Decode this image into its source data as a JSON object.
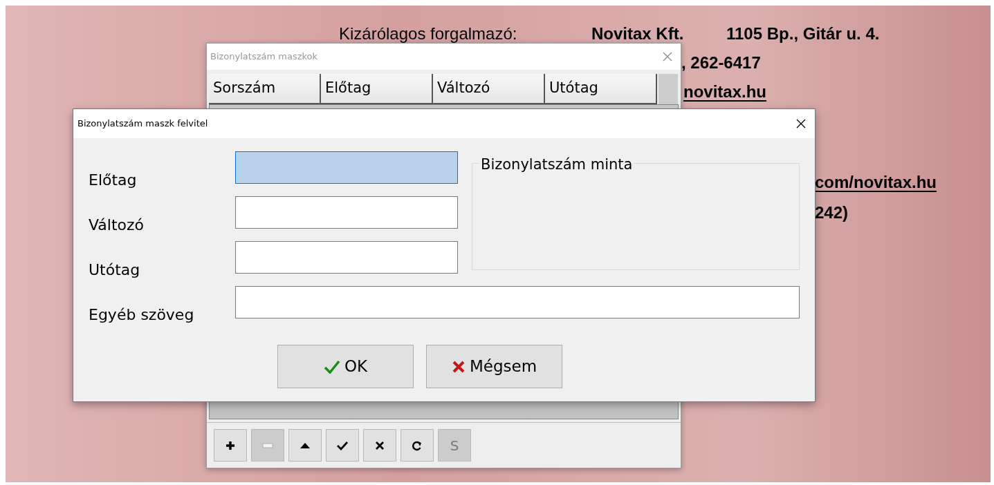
{
  "background_text": [
    {
      "text": "Kizárólagos forgalmazó:",
      "bold": false,
      "underline": false
    },
    {
      "text": "Novitax Kft.",
      "bold": true,
      "underline": false
    },
    {
      "text": "1105 Bp., Gitár u. 4.",
      "bold": true,
      "underline": false
    },
    {
      "text": ", 262-6417",
      "bold": true,
      "underline": false
    },
    {
      "text": "novitax.hu",
      "bold": true,
      "underline": true
    },
    {
      "text": "com/novitax.hu",
      "bold": true,
      "underline": true
    },
    {
      "text": "242)",
      "bold": true,
      "underline": false
    }
  ],
  "back_window": {
    "title": "Bizonylatszám maszkok",
    "columns": [
      "Sorszám",
      "Előtag",
      "Változó",
      "Utótag"
    ],
    "toolbar": [
      {
        "kind": "add",
        "disabled": false
      },
      {
        "kind": "remove",
        "disabled": true
      },
      {
        "kind": "up",
        "disabled": false
      },
      {
        "kind": "confirm",
        "disabled": false
      },
      {
        "kind": "cancel",
        "disabled": false
      },
      {
        "kind": "refresh",
        "disabled": false
      },
      {
        "kind": "text",
        "label": "S",
        "disabled": true
      }
    ]
  },
  "dialog": {
    "title": "Bizonylatszám maszk felvitel",
    "fields": [
      {
        "label": "Előtag",
        "focused": true
      },
      {
        "label": "Változó",
        "focused": false
      },
      {
        "label": "Utótag",
        "focused": false
      },
      {
        "label": "Egyéb szöveg",
        "focused": false
      }
    ],
    "sample_group": {
      "title": "Bizonylatszám minta"
    },
    "buttons": [
      {
        "kind": "ok",
        "label": "OK"
      },
      {
        "kind": "cancel",
        "label": "Mégsem"
      }
    ]
  }
}
